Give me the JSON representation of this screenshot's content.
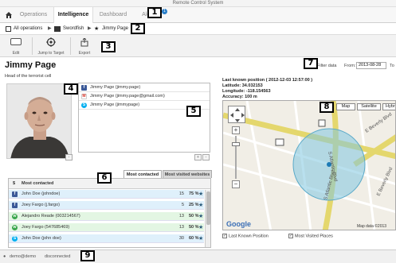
{
  "window": {
    "title": "Remote Control System"
  },
  "nav": {
    "tabs": [
      {
        "label": "Operations"
      },
      {
        "label": "Intelligence"
      },
      {
        "label": "Dashboard"
      },
      {
        "label": "Alerting"
      }
    ],
    "active_tab": "Intelligence",
    "alert_count": "1"
  },
  "breadcrumb": {
    "items": [
      {
        "label": "All operations"
      },
      {
        "label": "Swordfish"
      },
      {
        "label": "Jimmy Page"
      }
    ]
  },
  "toolbar": {
    "edit_label": "Edit",
    "jump_label": "Jump to Target",
    "export_label": "Export"
  },
  "person": {
    "name": "Jimmy Page",
    "subtitle": "Head of the terrorist cell"
  },
  "filter": {
    "label": "Filter data",
    "from_label": "From:",
    "from_value": "2013-08-28",
    "to_label": "To"
  },
  "accounts": [
    {
      "service": "facebook",
      "text": "Jimmy Page (jimmy.page)",
      "color": "#3b5998",
      "glyph": "f"
    },
    {
      "service": "gmail",
      "text": "Jimmy Page (jimmy.page@gmail.com)",
      "color": "#d93025",
      "glyph": "M"
    },
    {
      "service": "skype",
      "text": "Jimmy Page (jimmypage)",
      "color": "#00aff0",
      "glyph": "S"
    }
  ],
  "contacts": {
    "tabs": [
      {
        "label": "Most contacted"
      },
      {
        "label": "Most visited websites"
      }
    ],
    "active_tab": "Most contacted",
    "header_sort": "$",
    "header_label": "Most contacted",
    "rows": [
      {
        "service": "facebook",
        "glyph": "f",
        "color": "#3b5998",
        "name": "John Doe (johndoe)",
        "count": "15",
        "percent": "75 %",
        "bg": "#dff0fb"
      },
      {
        "service": "facebook",
        "glyph": "f",
        "color": "#3b5998",
        "name": "Joey Fargo (j.fargo)",
        "count": "5",
        "percent": "25 %",
        "bg": "#dff0fb"
      },
      {
        "service": "whatsapp",
        "glyph": "w",
        "color": "#3aa64c",
        "name": "Alejandro Reade (003214567)",
        "count": "13",
        "percent": "50 %",
        "bg": "#e3f6e3"
      },
      {
        "service": "whatsapp",
        "glyph": "w",
        "color": "#3aa64c",
        "name": "Joey Fargo (547685469)",
        "count": "13",
        "percent": "50 %",
        "bg": "#e3f6e3"
      },
      {
        "service": "skype",
        "glyph": "S",
        "color": "#00aff0",
        "name": "John Doe (john doe)",
        "count": "30",
        "percent": "60 %",
        "bg": "#dff0fb"
      }
    ]
  },
  "geo": {
    "title": "Last known position ( 2012-12-03 12:57:00 )",
    "latitude": "Latitude: 34.032153",
    "longitude": "Longitude: -118.154563",
    "accuracy": "Accuracy: 100 m",
    "map_buttons": [
      {
        "label": "Map"
      },
      {
        "label": "Satellite"
      },
      {
        "label": "Hybrid"
      }
    ],
    "map_brand": "Google",
    "map_attribution": "Map data ©2013",
    "streets": [
      {
        "label": "E Beverly Blvd"
      },
      {
        "label": "S Atlantic Blvd"
      },
      {
        "label": "S Atlantic Blvd"
      },
      {
        "label": "E Beverly Blvd"
      }
    ],
    "check_last_position": "Last Known Position",
    "check_visited": "Most Visited Places"
  },
  "status": {
    "user": "demo@demo",
    "state": "disconnected"
  },
  "annotations": [
    "1",
    "2",
    "3",
    "4",
    "5",
    "6",
    "7",
    "8",
    "9"
  ]
}
